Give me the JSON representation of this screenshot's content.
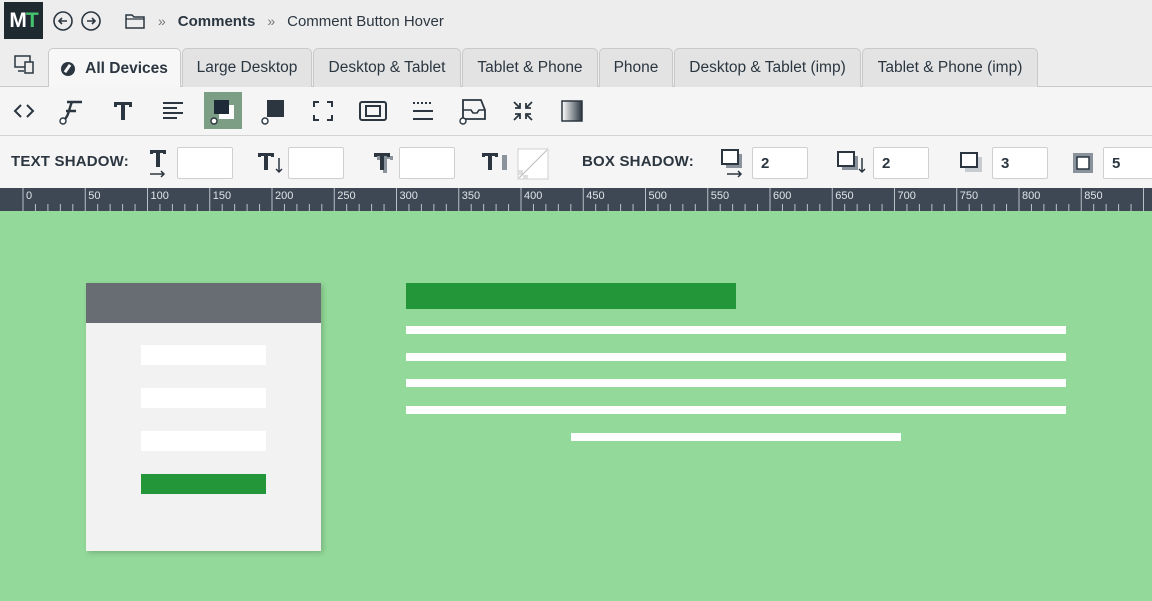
{
  "app": {
    "logo_text_m": "M",
    "logo_text_t": "T"
  },
  "breadcrumb": {
    "parent": "Comments",
    "separator": "»",
    "current": "Comment Button Hover"
  },
  "tabs": [
    {
      "label": "All Devices",
      "active": true
    },
    {
      "label": "Large Desktop"
    },
    {
      "label": "Desktop & Tablet"
    },
    {
      "label": "Tablet & Phone"
    },
    {
      "label": "Phone"
    },
    {
      "label": "Desktop & Tablet (imp)"
    },
    {
      "label": "Tablet & Phone (imp)"
    }
  ],
  "toolbar": {
    "tools": [
      "code-icon",
      "font-family-icon",
      "text-icon",
      "align-icon",
      "text-shadow-tool-icon",
      "box-color-icon",
      "expand-icon",
      "padding-icon",
      "line-spacing-icon",
      "tray-icon",
      "compress-icon",
      "gradient-icon"
    ],
    "active_tool": "text-shadow-tool-icon"
  },
  "props": {
    "text_shadow_label": "TEXT SHADOW:",
    "box_shadow_label": "BOX SHADOW:",
    "text_shadow_values": [
      "",
      "",
      ""
    ],
    "box_shadow_values": [
      "2",
      "2",
      "3",
      "5"
    ]
  },
  "ruler": {
    "labels": [
      "0",
      "50",
      "100",
      "150",
      "200",
      "250",
      "300",
      "350",
      "400",
      "450",
      "500",
      "550",
      "600",
      "650",
      "700",
      "750",
      "800",
      "850"
    ]
  },
  "colors": {
    "canvas": "#93d999",
    "accent_green": "#23963a",
    "ruler_bg": "#3d4854",
    "card_head": "#686d74"
  }
}
